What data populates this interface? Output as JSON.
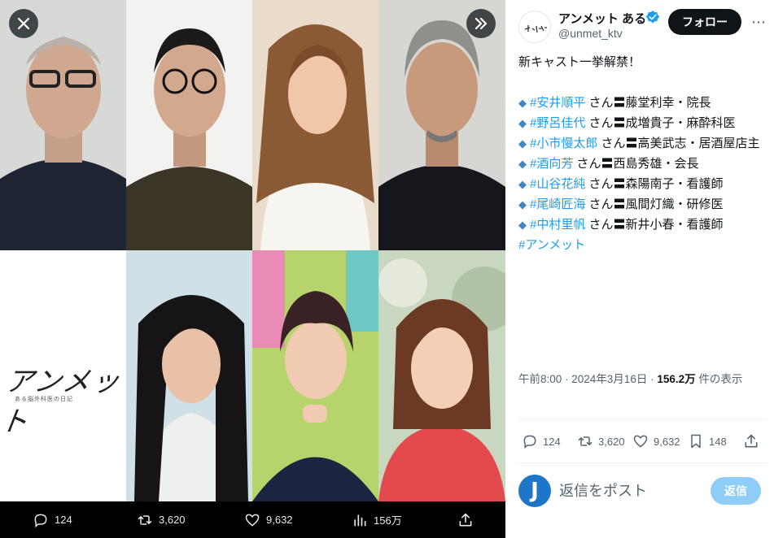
{
  "media": {
    "close_icon": "close-icon",
    "expand_icon": "chevron-double-right-icon",
    "logo_title": "アンメット",
    "logo_subtitle": "ある脳外科医の日記",
    "stats": {
      "replies": "124",
      "retweets": "3,620",
      "likes": "9,632",
      "views": "156万"
    }
  },
  "tweet": {
    "display_name": "アンメット ある",
    "handle": "@unmet_ktv",
    "follow_label": "フォロー",
    "headline": "新キャスト一挙解禁！",
    "cast": [
      {
        "tag": "#安井順平",
        "rest": " さん〓藤堂利幸・院長"
      },
      {
        "tag": "#野呂佳代",
        "rest": " さん〓成増貴子・麻酔科医"
      },
      {
        "tag": "#小市慢太郎",
        "rest": " さん〓高美武志・居酒屋店主"
      },
      {
        "tag": "#酒向芳",
        "rest": " さん〓西島秀雄・会長"
      },
      {
        "tag": "#山谷花純",
        "rest": " さん〓森陽南子・看護師"
      },
      {
        "tag": "#尾崎匠海",
        "rest": " さん〓風間灯織・研修医"
      },
      {
        "tag": "#中村里帆",
        "rest": " さん〓新井小春・看護師"
      }
    ],
    "hashtag": "#アンメット",
    "time": "午前8:00 · 2024年3月16日 · ",
    "views_count": "156.2万",
    "views_suffix": " 件の表示",
    "actions": {
      "replies": "124",
      "retweets": "3,620",
      "likes": "9,632",
      "bookmarks": "148"
    },
    "reply_avatar_letter": "J",
    "reply_placeholder": "返信をポスト",
    "reply_button": "返信"
  },
  "colors": {
    "accent": "#1d9bf0",
    "diamond": "#3e86c6",
    "reply_button": "#8ecdf8",
    "follow_button": "#0f1419"
  }
}
